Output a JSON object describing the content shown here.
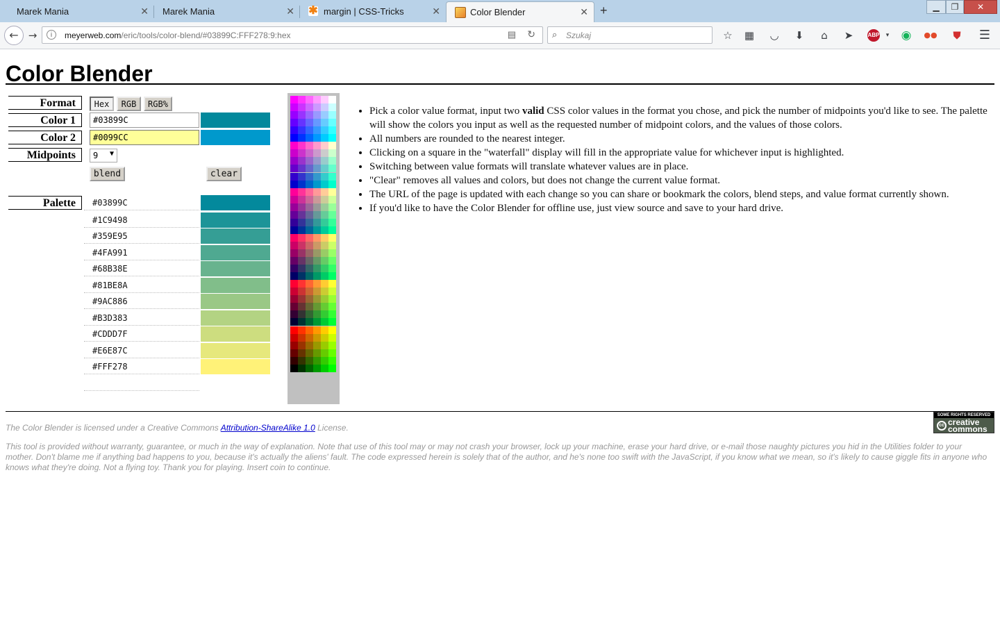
{
  "browser": {
    "tabs": [
      {
        "label": "Marek Mania",
        "active": false
      },
      {
        "label": "Marek Mania",
        "active": false
      },
      {
        "label": "margin | CSS-Tricks",
        "active": false
      },
      {
        "label": "Color Blender",
        "active": true
      }
    ],
    "url_domain": "meyerweb.com",
    "url_path": "/eric/tools/color-blend/#03899C:FFF278:9:hex",
    "search_placeholder": "Szukaj",
    "addon_badge": "ABP"
  },
  "page": {
    "title": "Color Blender"
  },
  "form": {
    "format_label": "Format",
    "format_options": [
      "Hex",
      "RGB",
      "RGB%"
    ],
    "format_selected": "Hex",
    "color1_label": "Color 1",
    "color1_value": "#03899C",
    "color2_label": "Color 2",
    "color2_value": "#0099CC",
    "midpoints_label": "Midpoints",
    "midpoints_value": "9",
    "blend_label": "blend",
    "clear_label": "clear",
    "palette_label": "Palette"
  },
  "colors": {
    "color1_swatch": "#03899C",
    "color2_swatch": "#0099CC",
    "color2_input_bg": "#FFFF99"
  },
  "palette": [
    "#03899C",
    "#1C9498",
    "#359E95",
    "#4FA991",
    "#68B38E",
    "#81BE8A",
    "#9AC886",
    "#B3D383",
    "#CDDD7F",
    "#E6E87C",
    "#FFF278"
  ],
  "instructions": {
    "item1_pre": "Pick a color value format, input two ",
    "item1_bold": "valid",
    "item1_post": " CSS color values in the format you chose, and pick the number of midpoints you'd like to see. The palette will show the colors you input as well as the requested number of midpoint colors, and the values of those colors.",
    "item2": "All numbers are rounded to the nearest integer.",
    "item3": "Clicking on a square in the \"waterfall\" display will fill in the appropriate value for whichever input is highlighted.",
    "item4": "Switching between value formats will translate whatever values are in place.",
    "item5": "\"Clear\" removes all values and colors, but does not change the current value format.",
    "item6": "The URL of the page is updated with each change so you can share or bookmark the colors, blend steps, and value format currently shown.",
    "item7": "If you'd like to have the Color Blender for offline use, just view source and save to your hard drive."
  },
  "footer": {
    "license_pre": "The Color Blender is licensed under a Creative Commons ",
    "license_link": "Attribution-ShareAlike 1.0",
    "license_post": " License.",
    "disclaimer": "This tool is provided without warranty, guarantee, or much in the way of explanation. Note that use of this tool may or may not crash your browser, lock up your machine, erase your hard drive, or e-mail those naughty pictures you hid in the Utilities folder to your mother. Don't blame me if anything bad happens to you, because it's actually the aliens' fault. The code expressed herein is solely that of the author, and he's none too swift with the JavaScript, if you know what we mean, so it's likely to cause giggle fits in anyone who knows what they're doing. Not a flying toy. Thank you for playing. Insert coin to continue.",
    "cc_top": "SOME RIGHTS RESERVED",
    "cc_name": "creative commons"
  },
  "waterfall": {
    "levels": [
      "FF",
      "CC",
      "99",
      "66",
      "33",
      "00"
    ]
  }
}
